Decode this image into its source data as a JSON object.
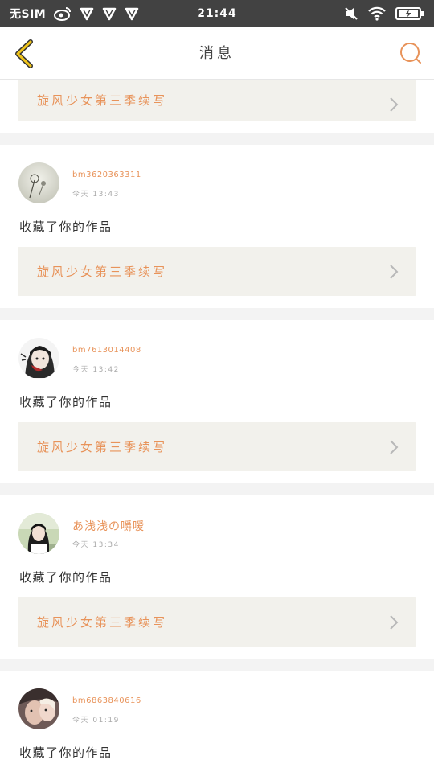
{
  "status_bar": {
    "carrier": "无SIM",
    "time": "21:44"
  },
  "nav": {
    "title": "消息"
  },
  "colors": {
    "accent": "#e8935a",
    "nav_back": "#f0c419",
    "status_bg": "#424242"
  },
  "top_work": {
    "title": "旋风少女第三季续写"
  },
  "entries": [
    {
      "username": "bm3620363311",
      "time": "今天 13:43",
      "action": "收藏了你的作品",
      "work_title": "旋风少女第三季续写"
    },
    {
      "username": "bm7613014408",
      "time": "今天 13:42",
      "action": "收藏了你的作品",
      "work_title": "旋风少女第三季续写"
    },
    {
      "username": "あ浅浅の嚼嗳",
      "time": "今天 13:34",
      "action": "收藏了你的作品",
      "work_title": "旋风少女第三季续写"
    },
    {
      "username": "bm6863840616",
      "time": "今天 01:19",
      "action": "收藏了你的作品"
    }
  ]
}
